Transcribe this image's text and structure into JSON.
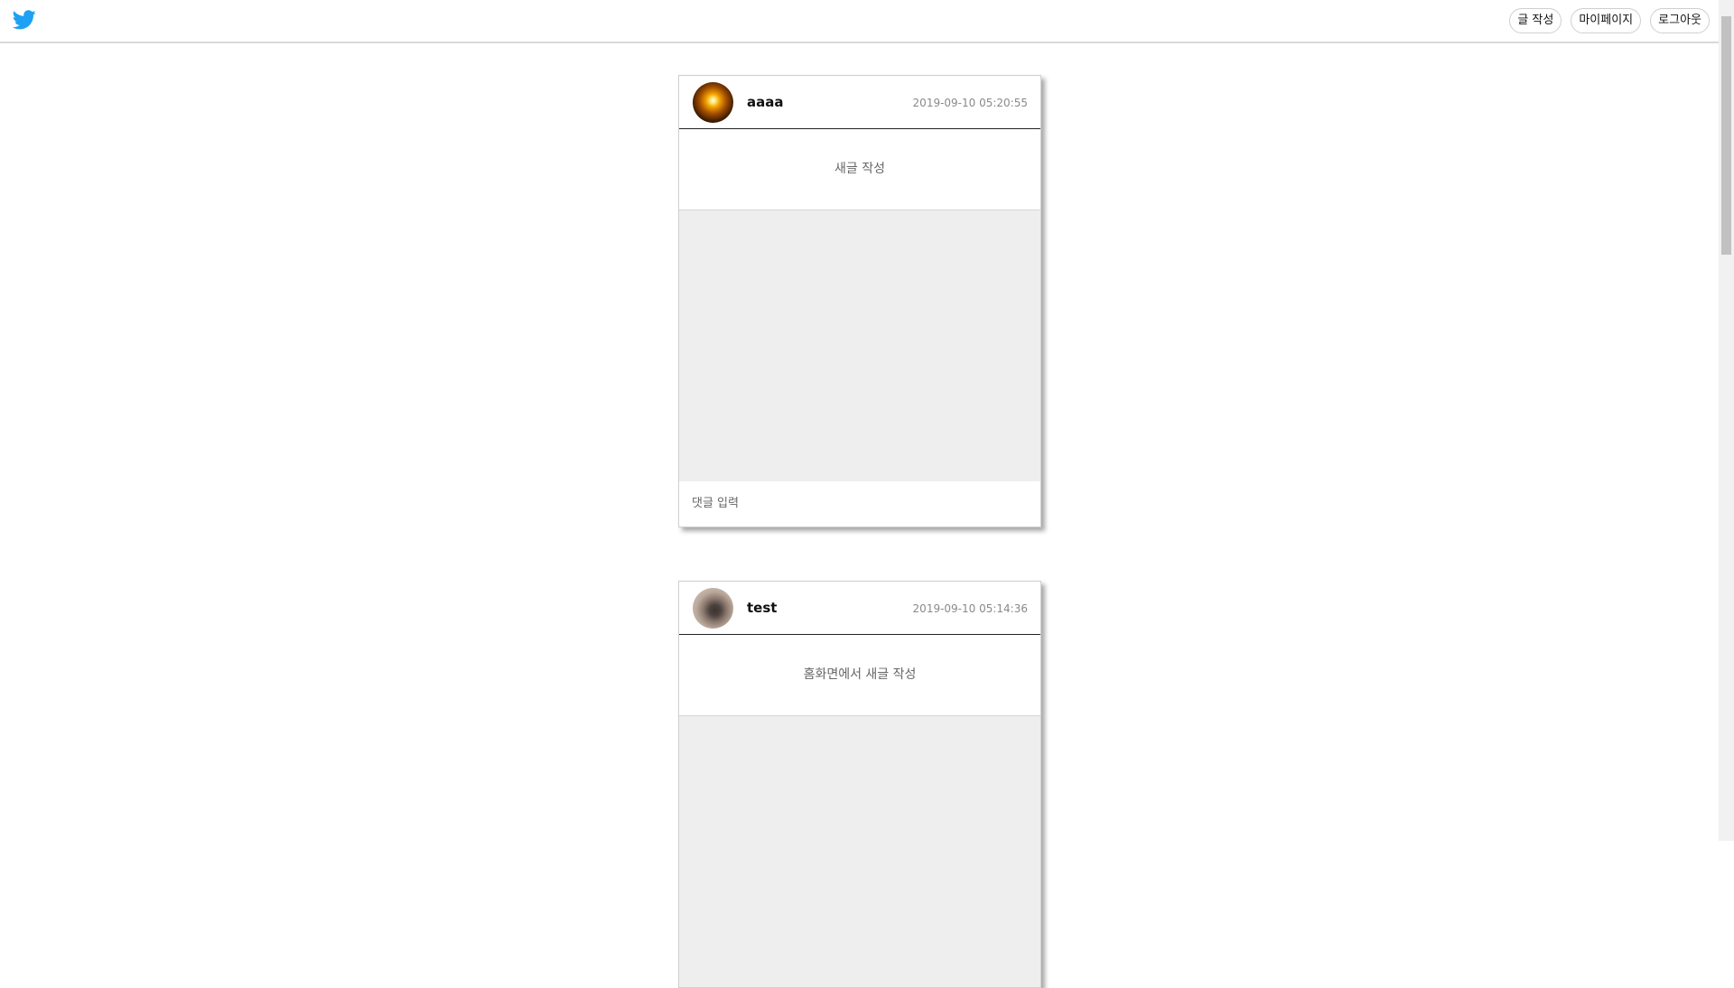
{
  "header": {
    "logo_icon": "twitter-bird-icon",
    "brand_color": "#1da1f2",
    "buttons": {
      "write": "글 작성",
      "mypage": "마이페이지",
      "logout": "로그아웃"
    }
  },
  "posts": [
    {
      "username": "aaaa",
      "timestamp": "2019-09-10 05:20:55",
      "content": "새글 작성",
      "comment_placeholder": "댓글 입력"
    },
    {
      "username": "test",
      "timestamp": "2019-09-10 05:14:36",
      "content": "홈화면에서 새글 작성"
    }
  ]
}
